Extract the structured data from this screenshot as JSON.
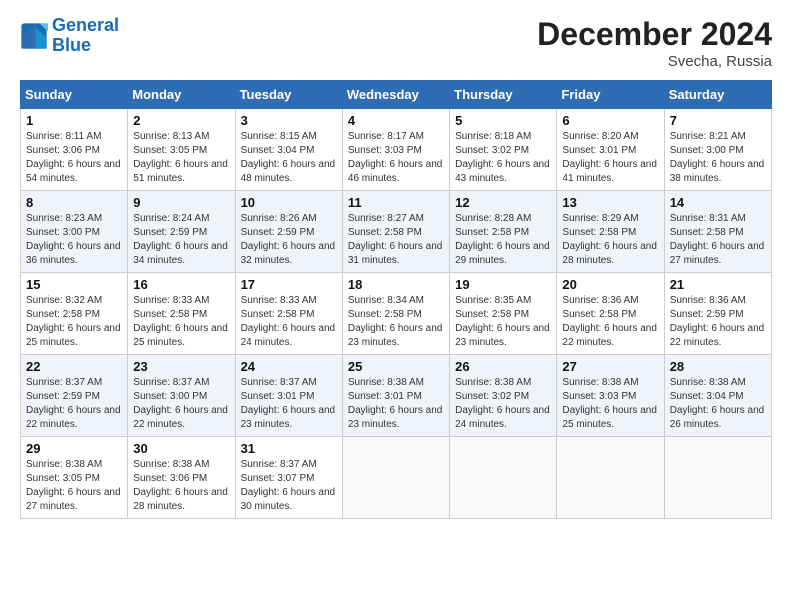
{
  "logo": {
    "line1": "General",
    "line2": "Blue"
  },
  "title": "December 2024",
  "location": "Svecha, Russia",
  "days_header": [
    "Sunday",
    "Monday",
    "Tuesday",
    "Wednesday",
    "Thursday",
    "Friday",
    "Saturday"
  ],
  "weeks": [
    [
      {
        "day": "1",
        "sunrise": "Sunrise: 8:11 AM",
        "sunset": "Sunset: 3:06 PM",
        "daylight": "Daylight: 6 hours and 54 minutes."
      },
      {
        "day": "2",
        "sunrise": "Sunrise: 8:13 AM",
        "sunset": "Sunset: 3:05 PM",
        "daylight": "Daylight: 6 hours and 51 minutes."
      },
      {
        "day": "3",
        "sunrise": "Sunrise: 8:15 AM",
        "sunset": "Sunset: 3:04 PM",
        "daylight": "Daylight: 6 hours and 48 minutes."
      },
      {
        "day": "4",
        "sunrise": "Sunrise: 8:17 AM",
        "sunset": "Sunset: 3:03 PM",
        "daylight": "Daylight: 6 hours and 46 minutes."
      },
      {
        "day": "5",
        "sunrise": "Sunrise: 8:18 AM",
        "sunset": "Sunset: 3:02 PM",
        "daylight": "Daylight: 6 hours and 43 minutes."
      },
      {
        "day": "6",
        "sunrise": "Sunrise: 8:20 AM",
        "sunset": "Sunset: 3:01 PM",
        "daylight": "Daylight: 6 hours and 41 minutes."
      },
      {
        "day": "7",
        "sunrise": "Sunrise: 8:21 AM",
        "sunset": "Sunset: 3:00 PM",
        "daylight": "Daylight: 6 hours and 38 minutes."
      }
    ],
    [
      {
        "day": "8",
        "sunrise": "Sunrise: 8:23 AM",
        "sunset": "Sunset: 3:00 PM",
        "daylight": "Daylight: 6 hours and 36 minutes."
      },
      {
        "day": "9",
        "sunrise": "Sunrise: 8:24 AM",
        "sunset": "Sunset: 2:59 PM",
        "daylight": "Daylight: 6 hours and 34 minutes."
      },
      {
        "day": "10",
        "sunrise": "Sunrise: 8:26 AM",
        "sunset": "Sunset: 2:59 PM",
        "daylight": "Daylight: 6 hours and 32 minutes."
      },
      {
        "day": "11",
        "sunrise": "Sunrise: 8:27 AM",
        "sunset": "Sunset: 2:58 PM",
        "daylight": "Daylight: 6 hours and 31 minutes."
      },
      {
        "day": "12",
        "sunrise": "Sunrise: 8:28 AM",
        "sunset": "Sunset: 2:58 PM",
        "daylight": "Daylight: 6 hours and 29 minutes."
      },
      {
        "day": "13",
        "sunrise": "Sunrise: 8:29 AM",
        "sunset": "Sunset: 2:58 PM",
        "daylight": "Daylight: 6 hours and 28 minutes."
      },
      {
        "day": "14",
        "sunrise": "Sunrise: 8:31 AM",
        "sunset": "Sunset: 2:58 PM",
        "daylight": "Daylight: 6 hours and 27 minutes."
      }
    ],
    [
      {
        "day": "15",
        "sunrise": "Sunrise: 8:32 AM",
        "sunset": "Sunset: 2:58 PM",
        "daylight": "Daylight: 6 hours and 25 minutes."
      },
      {
        "day": "16",
        "sunrise": "Sunrise: 8:33 AM",
        "sunset": "Sunset: 2:58 PM",
        "daylight": "Daylight: 6 hours and 25 minutes."
      },
      {
        "day": "17",
        "sunrise": "Sunrise: 8:33 AM",
        "sunset": "Sunset: 2:58 PM",
        "daylight": "Daylight: 6 hours and 24 minutes."
      },
      {
        "day": "18",
        "sunrise": "Sunrise: 8:34 AM",
        "sunset": "Sunset: 2:58 PM",
        "daylight": "Daylight: 6 hours and 23 minutes."
      },
      {
        "day": "19",
        "sunrise": "Sunrise: 8:35 AM",
        "sunset": "Sunset: 2:58 PM",
        "daylight": "Daylight: 6 hours and 23 minutes."
      },
      {
        "day": "20",
        "sunrise": "Sunrise: 8:36 AM",
        "sunset": "Sunset: 2:58 PM",
        "daylight": "Daylight: 6 hours and 22 minutes."
      },
      {
        "day": "21",
        "sunrise": "Sunrise: 8:36 AM",
        "sunset": "Sunset: 2:59 PM",
        "daylight": "Daylight: 6 hours and 22 minutes."
      }
    ],
    [
      {
        "day": "22",
        "sunrise": "Sunrise: 8:37 AM",
        "sunset": "Sunset: 2:59 PM",
        "daylight": "Daylight: 6 hours and 22 minutes."
      },
      {
        "day": "23",
        "sunrise": "Sunrise: 8:37 AM",
        "sunset": "Sunset: 3:00 PM",
        "daylight": "Daylight: 6 hours and 22 minutes."
      },
      {
        "day": "24",
        "sunrise": "Sunrise: 8:37 AM",
        "sunset": "Sunset: 3:01 PM",
        "daylight": "Daylight: 6 hours and 23 minutes."
      },
      {
        "day": "25",
        "sunrise": "Sunrise: 8:38 AM",
        "sunset": "Sunset: 3:01 PM",
        "daylight": "Daylight: 6 hours and 23 minutes."
      },
      {
        "day": "26",
        "sunrise": "Sunrise: 8:38 AM",
        "sunset": "Sunset: 3:02 PM",
        "daylight": "Daylight: 6 hours and 24 minutes."
      },
      {
        "day": "27",
        "sunrise": "Sunrise: 8:38 AM",
        "sunset": "Sunset: 3:03 PM",
        "daylight": "Daylight: 6 hours and 25 minutes."
      },
      {
        "day": "28",
        "sunrise": "Sunrise: 8:38 AM",
        "sunset": "Sunset: 3:04 PM",
        "daylight": "Daylight: 6 hours and 26 minutes."
      }
    ],
    [
      {
        "day": "29",
        "sunrise": "Sunrise: 8:38 AM",
        "sunset": "Sunset: 3:05 PM",
        "daylight": "Daylight: 6 hours and 27 minutes."
      },
      {
        "day": "30",
        "sunrise": "Sunrise: 8:38 AM",
        "sunset": "Sunset: 3:06 PM",
        "daylight": "Daylight: 6 hours and 28 minutes."
      },
      {
        "day": "31",
        "sunrise": "Sunrise: 8:37 AM",
        "sunset": "Sunset: 3:07 PM",
        "daylight": "Daylight: 6 hours and 30 minutes."
      },
      null,
      null,
      null,
      null
    ]
  ]
}
